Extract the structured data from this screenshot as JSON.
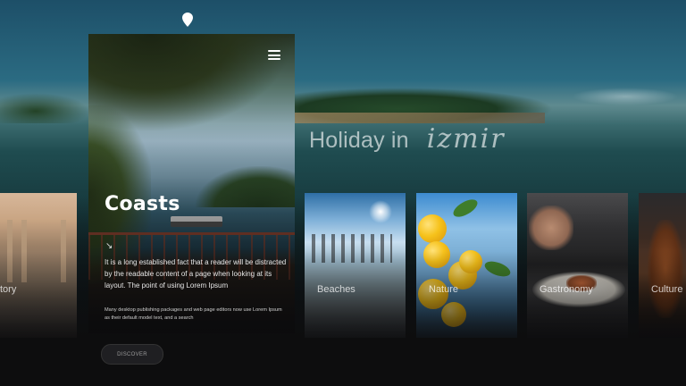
{
  "hero": {
    "title_plain": "Holiday in",
    "title_script": "izmir"
  },
  "featured": {
    "title": "Coasts",
    "arrow_glyph": "↘",
    "description": "It is a long established fact that a reader will be distracted by the readable content of a page when looking at its layout. The point of using Lorem Ipsum",
    "description_small": "Many desktop publishing packages and web page editors now use Lorem Ipsum as their default model text, and a search",
    "cta_label": "DISCOVER"
  },
  "categories": [
    {
      "label": "tory"
    },
    {
      "label": "Beaches"
    },
    {
      "label": "Nature"
    },
    {
      "label": "Gastronomy"
    },
    {
      "label": "Culture"
    }
  ],
  "icons": {
    "pin": "location-pin-icon",
    "menu": "hamburger-menu-icon"
  },
  "colors": {
    "background": "#0d0d0e",
    "railing": "#a5503a",
    "button_bg": "#1f1f22"
  }
}
